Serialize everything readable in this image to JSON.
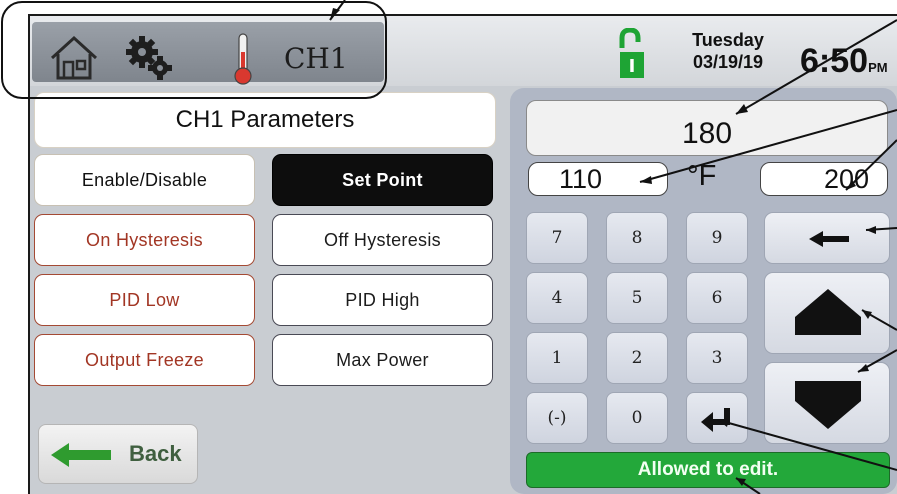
{
  "header": {
    "channel_label": "CH1",
    "day": "Tuesday",
    "date": "03/19/19",
    "time": "6:50",
    "ampm": "PM",
    "icons": [
      "home-icon",
      "gear-icon",
      "thermometer-icon",
      "unlocked-padlock-icon"
    ],
    "lock_glyph": "I"
  },
  "panel": {
    "title": "CH1 Parameters"
  },
  "menu": {
    "enable_disable": "Enable/Disable",
    "set_point": "Set Point",
    "on_hysteresis": "On Hysteresis",
    "off_hysteresis": "Off Hysteresis",
    "pid_low": "PID Low",
    "pid_high": "PID High",
    "output_freeze": "Output Freeze",
    "max_power": "Max Power"
  },
  "back_label": "Back",
  "entry": {
    "value": "180",
    "min": "110",
    "unit": "°F",
    "max": "200"
  },
  "keys": {
    "k7": "7",
    "k8": "8",
    "k9": "9",
    "k4": "4",
    "k5": "5",
    "k6": "6",
    "k1": "1",
    "k2": "2",
    "k3": "3",
    "kneg": "(-)",
    "k0": "0"
  },
  "status": "Allowed to edit.",
  "colors": {
    "status_green": "#23a83a",
    "lock_green": "#1ea434",
    "thermometer_red": "#d9382f",
    "active_tab": "#0d0d0d"
  }
}
